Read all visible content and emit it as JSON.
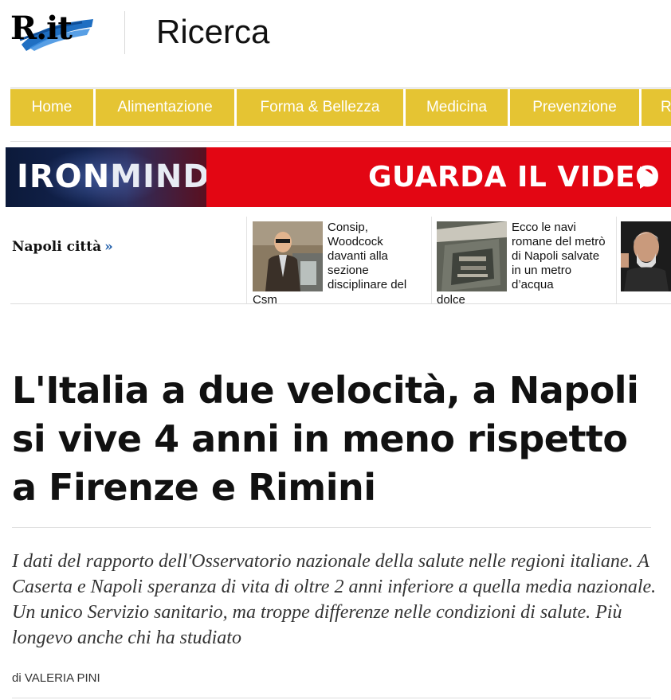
{
  "header": {
    "logo_text": "R.it",
    "section_title": "Ricerca"
  },
  "nav": {
    "items": [
      {
        "label": "Home"
      },
      {
        "label": "Alimentazione"
      },
      {
        "label": "Forma & Bellezza"
      },
      {
        "label": "Medicina"
      },
      {
        "label": "Prevenzione"
      },
      {
        "label": "R"
      }
    ],
    "color": "#e5c433"
  },
  "banner": {
    "brand_part1": "IRON",
    "brand_part2": "MIND",
    "cta": "GUARDA IL VIDEO",
    "cta_icon": "play-icon",
    "color": "#e30613"
  },
  "city": {
    "label": "Napoli città",
    "arrow": "»"
  },
  "teasers": [
    {
      "text": "Consip, Woodcock davanti alla sezione disciplinare del",
      "tail": "Csm"
    },
    {
      "text": "Ecco le navi romane del metrò di Napoli salvate in un metro d’acqua",
      "tail": "dolce"
    },
    {
      "text": "",
      "tail": ""
    }
  ],
  "article": {
    "title": "L'Italia a due velocità, a Napoli si vive 4 anni in meno rispetto a Firenze e Rimini",
    "summary": "I dati del rapporto dell'Osservatorio nazionale della salute nelle regioni italiane. A Caserta e Napoli speranza di vita di oltre 2 anni inferiore a quella media nazionale. Un unico Servizio sanitario, ma troppe differenze nelle condizioni di salute. Più longevo anche chi ha studiato",
    "byline_prefix": "di",
    "author": "VALERIA PINI"
  }
}
